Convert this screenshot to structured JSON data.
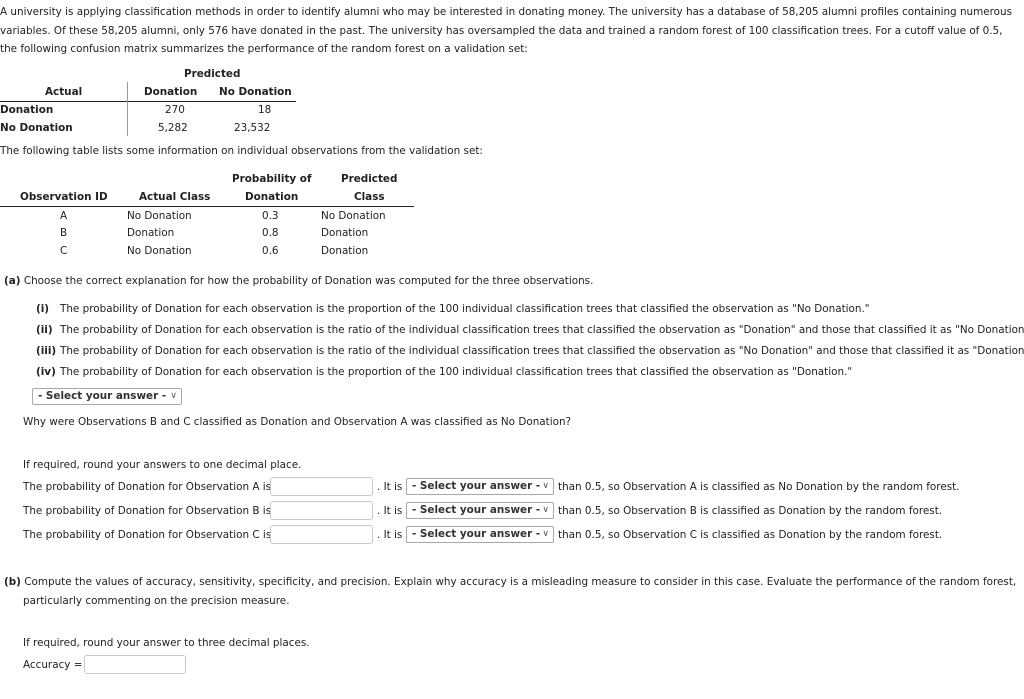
{
  "intro": "A university is applying classification methods in order to identify alumni who may be interested in donating money. The university has a database of 58,205 alumni profiles containing numerous variables. Of these 58,205 alumni, only 576 have donated in the past. The university has oversampled the data and trained a random forest of 100 classification trees. For a cutoff value of 0.5, the following confusion matrix summarizes the performance of the random forest on a validation set:",
  "confusion_matrix": {
    "predicted_header": "Predicted",
    "actual_header": "Actual",
    "columns": [
      "Donation",
      "No Donation"
    ],
    "rows": [
      {
        "label": "Donation",
        "values": [
          "270",
          "18"
        ]
      },
      {
        "label": "No Donation",
        "values": [
          "5,282",
          "23,532"
        ]
      }
    ]
  },
  "obs_intro": "The following table lists some information on individual observations from the validation set:",
  "obs_table": {
    "headers": {
      "id": "Observation ID",
      "actual": "Actual Class",
      "prob_line1": "Probability of",
      "prob_line2": "Donation",
      "pred_line1": "Predicted",
      "pred_line2": "Class"
    },
    "rows": [
      {
        "id": "A",
        "actual": "No Donation",
        "prob": "0.3",
        "pred": "No Donation"
      },
      {
        "id": "B",
        "actual": "Donation",
        "prob": "0.8",
        "pred": "Donation"
      },
      {
        "id": "C",
        "actual": "No Donation",
        "prob": "0.6",
        "pred": "Donation"
      }
    ]
  },
  "part_a": {
    "label": "(a)",
    "question": "Choose the correct explanation for how the probability of Donation was computed for the three observations.",
    "options": [
      {
        "num": "(i)",
        "text": "The probability of Donation for each observation is the proportion of the 100 individual classification trees that classified the observation as \"No Donation.\""
      },
      {
        "num": "(ii)",
        "text": "The probability of Donation for each observation is the ratio of the individual classification trees that classified the observation as \"Donation\" and those that classified it as \"No Donation.\""
      },
      {
        "num": "(iii)",
        "text": "The probability of Donation for each observation is the ratio of the individual classification trees that classified the observation as \"No Donation\" and those that classified it as \"Donation.\""
      },
      {
        "num": "(iv)",
        "text": "The probability of Donation for each observation is the proportion of the 100 individual classification trees that classified the observation as \"Donation.\""
      }
    ],
    "select_placeholder": "- Select your answer -",
    "why_question": "Why were Observations B and C classified as Donation and Observation A was classified as No Donation?",
    "round_note": "If required, round your answers to one decimal place.",
    "rows": [
      {
        "prefix": "The probability of Donation for Observation A is",
        "mid": ". It is",
        "select": "- Select your answer -",
        "suffix": "than 0.5, so Observation A is classified as No Donation by the random forest.",
        "value": ""
      },
      {
        "prefix": "The probability of Donation for Observation B is",
        "mid": ". It is",
        "select": "- Select your answer -",
        "suffix": "than 0.5, so Observation B is classified as Donation by the random forest.",
        "value": ""
      },
      {
        "prefix": "The probability of Donation for Observation C is",
        "mid": ". It is",
        "select": "- Select your answer -",
        "suffix": "than 0.5, so Observation C is classified as Donation by the random forest.",
        "value": ""
      }
    ]
  },
  "part_b": {
    "label": "(b)",
    "question": "Compute the values of accuracy, sensitivity, specificity, and precision. Explain why accuracy is a misleading measure to consider in this case. Evaluate the performance of the random forest,",
    "question_cont": "particularly commenting on the precision measure.",
    "round_note": "If required, round your answer to three decimal places.",
    "accuracy_label": "Accuracy =",
    "accuracy_value": ""
  },
  "icons": {
    "select_chevron": "chevron-down-icon",
    "chevron_glyph": "∨"
  }
}
